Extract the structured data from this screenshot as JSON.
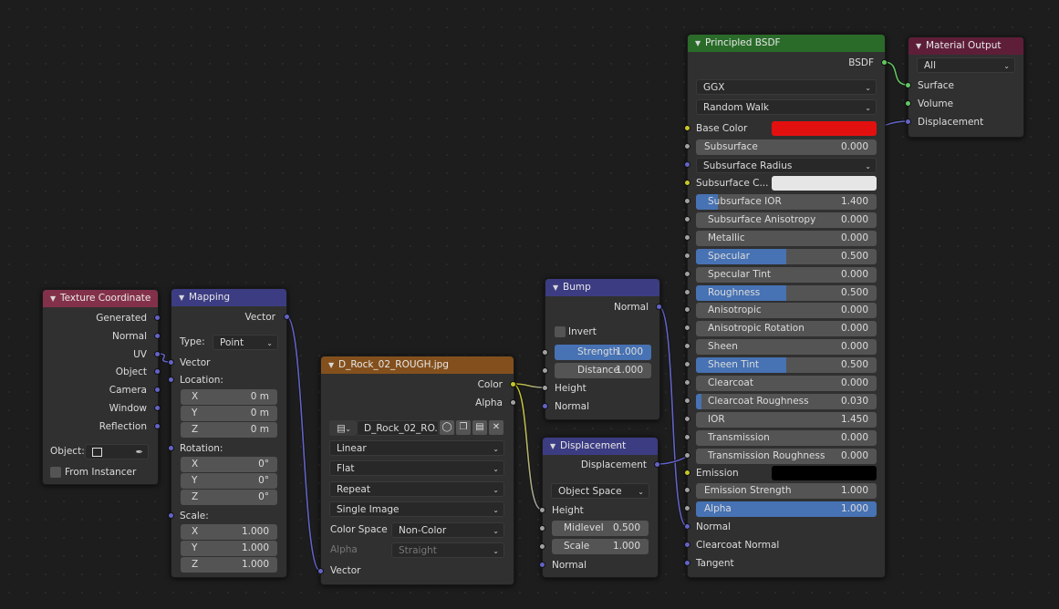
{
  "colors": {
    "vector_socket": "#6363c7",
    "color_socket": "#c7c729",
    "float_socket": "#a1a1a1",
    "shader_socket": "#63c763",
    "slider_fill": "#4772b3",
    "base_color": "#e31010",
    "subsurface_color": "#e6e6e6",
    "emission_color": "#000000"
  },
  "texcoord": {
    "title": "Texture Coordinate",
    "outputs": [
      "Generated",
      "Normal",
      "UV",
      "Object",
      "Camera",
      "Window",
      "Reflection"
    ],
    "object_label": "Object:",
    "from_instancer": "From Instancer"
  },
  "mapping": {
    "title": "Mapping",
    "output": "Vector",
    "type_label": "Type:",
    "type_value": "Point",
    "input_vector": "Vector",
    "location_label": "Location:",
    "location": [
      {
        "axis": "X",
        "value": "0 m"
      },
      {
        "axis": "Y",
        "value": "0 m"
      },
      {
        "axis": "Z",
        "value": "0 m"
      }
    ],
    "rotation_label": "Rotation:",
    "rotation": [
      {
        "axis": "X",
        "value": "0°"
      },
      {
        "axis": "Y",
        "value": "0°"
      },
      {
        "axis": "Z",
        "value": "0°"
      }
    ],
    "scale_label": "Scale:",
    "scale": [
      {
        "axis": "X",
        "value": "1.000"
      },
      {
        "axis": "Y",
        "value": "1.000"
      },
      {
        "axis": "Z",
        "value": "1.000"
      }
    ]
  },
  "image": {
    "title": "D_Rock_02_ROUGH.jpg",
    "out_color": "Color",
    "out_alpha": "Alpha",
    "image_name": "D_Rock_02_RO...",
    "interpolation": "Linear",
    "projection": "Flat",
    "extension": "Repeat",
    "source": "Single Image",
    "color_space_label": "Color Space",
    "color_space_value": "Non-Color",
    "alpha_label": "Alpha",
    "alpha_value": "Straight",
    "input_vector": "Vector"
  },
  "bump": {
    "title": "Bump",
    "output": "Normal",
    "invert_label": "Invert",
    "strength_label": "Strength",
    "strength_value": "1.000",
    "distance_label": "Distance",
    "distance_value": "1.000",
    "height_label": "Height",
    "normal_label": "Normal"
  },
  "displacement": {
    "title": "Displacement",
    "output": "Displacement",
    "space": "Object Space",
    "height_label": "Height",
    "midlevel_label": "Midlevel",
    "midlevel_value": "0.500",
    "scale_label": "Scale",
    "scale_value": "1.000",
    "normal_label": "Normal"
  },
  "bsdf": {
    "title": "Principled BSDF",
    "output": "BSDF",
    "distribution": "GGX",
    "subsurface_method": "Random Walk",
    "base_color_label": "Base Color",
    "subsurface_label": "Subsurface",
    "subsurface_value": "0.000",
    "subsurface_radius_label": "Subsurface Radius",
    "subsurface_color_label": "Subsurface C...",
    "sliders": [
      {
        "label": "Subsurface IOR",
        "value": "1.400",
        "fill": 0.12
      },
      {
        "label": "Subsurface Anisotropy",
        "value": "0.000",
        "fill": 0
      },
      {
        "label": "Metallic",
        "value": "0.000",
        "fill": 0
      },
      {
        "label": "Specular",
        "value": "0.500",
        "fill": 0.5
      },
      {
        "label": "Specular Tint",
        "value": "0.000",
        "fill": 0
      },
      {
        "label": "Roughness",
        "value": "0.500",
        "fill": 0.5
      },
      {
        "label": "Anisotropic",
        "value": "0.000",
        "fill": 0
      },
      {
        "label": "Anisotropic Rotation",
        "value": "0.000",
        "fill": 0
      },
      {
        "label": "Sheen",
        "value": "0.000",
        "fill": 0
      },
      {
        "label": "Sheen Tint",
        "value": "0.500",
        "fill": 0.5
      },
      {
        "label": "Clearcoat",
        "value": "0.000",
        "fill": 0
      },
      {
        "label": "Clearcoat Roughness",
        "value": "0.030",
        "fill": 0.03
      },
      {
        "label": "IOR",
        "value": "1.450",
        "fill": 0
      },
      {
        "label": "Transmission",
        "value": "0.000",
        "fill": 0
      },
      {
        "label": "Transmission Roughness",
        "value": "0.000",
        "fill": 0
      }
    ],
    "emission_label": "Emission",
    "emission_strength_label": "Emission Strength",
    "emission_strength_value": "1.000",
    "alpha_label": "Alpha",
    "alpha_value": "1.000",
    "alpha_fill": 1,
    "normal_label": "Normal",
    "clearcoat_normal_label": "Clearcoat Normal",
    "tangent_label": "Tangent"
  },
  "output": {
    "title": "Material Output",
    "target": "All",
    "surface": "Surface",
    "volume": "Volume",
    "displacement": "Displacement"
  }
}
